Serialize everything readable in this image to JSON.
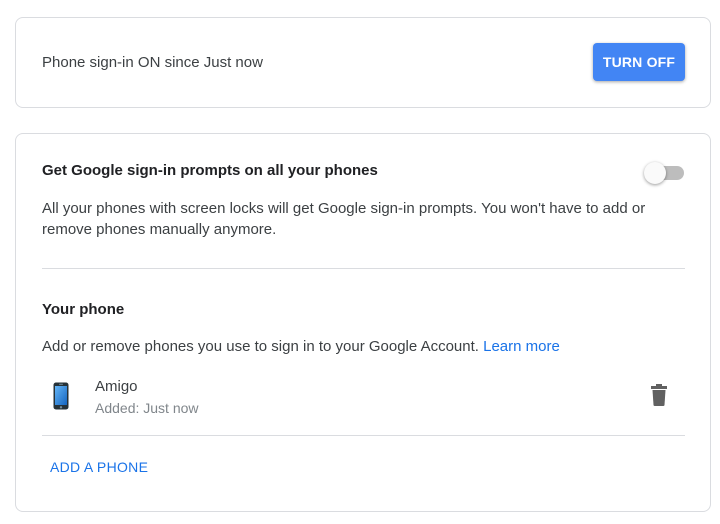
{
  "status": {
    "text": "Phone sign-in ON since Just now",
    "turn_off_label": "TURN OFF"
  },
  "prompts": {
    "title": "Get Google sign-in prompts on all your phones",
    "description": "All your phones with screen locks will get Google sign-in prompts. You won't have to add or remove phones manually anymore.",
    "toggle_on": false
  },
  "your_phone": {
    "title": "Your phone",
    "description": "Add or remove phones you use to sign in to your Google Account.",
    "learn_more": "Learn more",
    "phones": [
      {
        "name": "Amigo",
        "added": "Added: Just now",
        "icon": "smartphone-icon"
      }
    ],
    "delete_icon": "trash-icon",
    "add_phone_label": "ADD A PHONE"
  },
  "colors": {
    "primary": "#4285f4",
    "link": "#1a73e8",
    "border": "#dadce0"
  }
}
